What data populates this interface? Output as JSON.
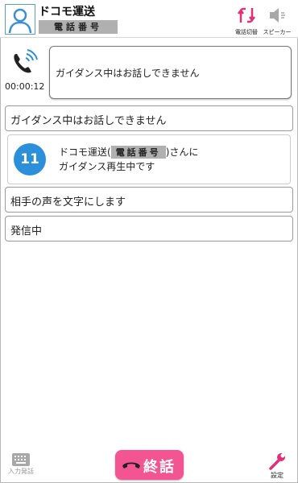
{
  "header": {
    "contact_name": "ドコモ運送",
    "phone_number_label": "電話番号",
    "phone_switch_label": "電話切替",
    "speaker_label": "スピーカー"
  },
  "call": {
    "timer": "00:00:12",
    "guidance_message": "ガイダンス中はお話しできません"
  },
  "log": {
    "row1": "ガイダンス中はお話しできません",
    "info": {
      "count": "11",
      "line1_prefix": "ドコモ運送(",
      "line1_redacted": "電話番号",
      "line1_suffix": ")さんに",
      "line2": "ガイダンス再生中です"
    },
    "row2": "相手の声を文字にします",
    "row3": "発信中"
  },
  "footer": {
    "keypad_label": "入力発話",
    "end_call_label": "終話",
    "settings_label": "設定"
  },
  "colors": {
    "accent_pink": "#f25592",
    "accent_blue": "#2b8fd9",
    "redaction_gray": "#b0b0b0"
  },
  "icons": [
    "person-icon",
    "phone-switch-icon",
    "speaker-icon",
    "phone-ringing-icon",
    "keyboard-icon",
    "handset-icon",
    "wrench-icon"
  ]
}
